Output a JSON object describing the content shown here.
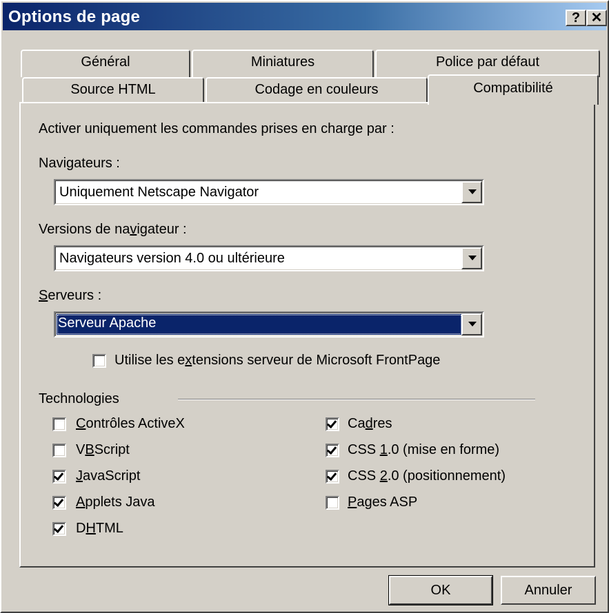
{
  "window": {
    "title": "Options de page",
    "help_button": "?",
    "close_button": "✕"
  },
  "tabs": {
    "row1": [
      "Général",
      "Miniatures",
      "Police par défaut"
    ],
    "row2": [
      "Source HTML",
      "Codage en couleurs",
      "Compatibilité"
    ],
    "active": "Compatibilité"
  },
  "panel": {
    "intro": "Activer uniquement les commandes prises en charge par :",
    "browsers": {
      "label_a": "Navi",
      "label_u": "g",
      "label_b": "ateurs :",
      "value": "Uniquement Netscape Navigator"
    },
    "browser_versions": {
      "label_a": "Versions de na",
      "label_u": "v",
      "label_b": "igateur :",
      "value": "Navigateurs version 4.0 ou ultérieure"
    },
    "servers": {
      "label_u": "S",
      "label_b": "erveurs :",
      "value": "Serveur Apache"
    },
    "frontpage_ext": {
      "label_a": "Utilise les e",
      "label_u": "x",
      "label_b": "tensions serveur de Microsoft FrontPage",
      "checked": false
    },
    "technologies_label": "Technologies",
    "technologies_left": [
      {
        "a": "",
        "u": "C",
        "b": "ontrôles ActiveX",
        "checked": false
      },
      {
        "a": "V",
        "u": "B",
        "b": "Script",
        "checked": false
      },
      {
        "a": "",
        "u": "J",
        "b": "avaScript",
        "checked": true
      },
      {
        "a": "",
        "u": "A",
        "b": "pplets Java",
        "checked": true
      },
      {
        "a": "D",
        "u": "H",
        "b": "TML",
        "checked": true
      }
    ],
    "technologies_right": [
      {
        "a": "Ca",
        "u": "d",
        "b": "res",
        "checked": true
      },
      {
        "a": "CSS ",
        "u": "1",
        "b": ".0 (mise en forme)",
        "checked": true
      },
      {
        "a": "CSS ",
        "u": "2",
        "b": ".0 (positionnement)",
        "checked": true
      },
      {
        "a": "",
        "u": "P",
        "b": "ages ASP",
        "checked": false
      }
    ]
  },
  "buttons": {
    "ok": "OK",
    "cancel": "Annuler"
  }
}
